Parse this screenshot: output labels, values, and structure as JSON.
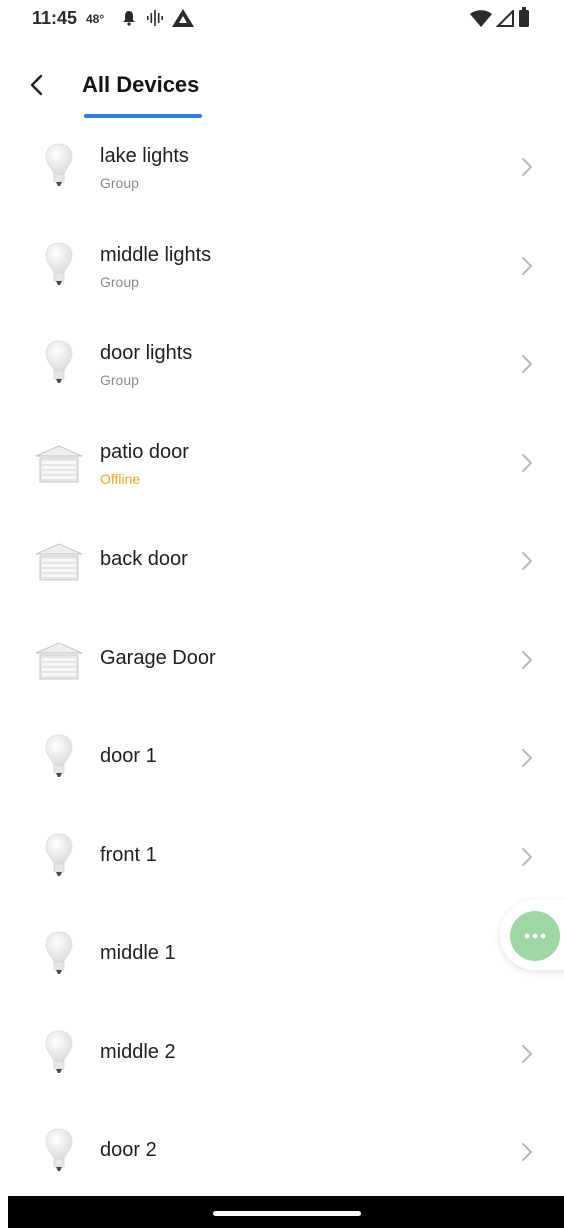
{
  "status_bar": {
    "time": "11:45",
    "temperature": "48°",
    "icons": [
      "notification-bell-icon",
      "vibrate-icon",
      "drive-icon",
      "wifi-icon",
      "signal-icon",
      "battery-icon"
    ]
  },
  "header": {
    "title": "All Devices",
    "back_icon": "chevron-left-icon",
    "accent_color": "#2f7ae5"
  },
  "devices": [
    {
      "name": "lake lights",
      "subtitle": "Group",
      "icon": "bulb-icon"
    },
    {
      "name": "middle lights",
      "subtitle": "Group",
      "icon": "bulb-icon"
    },
    {
      "name": "door lights",
      "subtitle": "Group",
      "icon": "bulb-icon"
    },
    {
      "name": "patio door",
      "subtitle": "Offline",
      "icon": "garage-door-icon",
      "status_color": "#f5a623"
    },
    {
      "name": "back door",
      "subtitle": "",
      "icon": "garage-door-icon"
    },
    {
      "name": "Garage Door",
      "subtitle": "",
      "icon": "garage-door-icon"
    },
    {
      "name": "door 1",
      "subtitle": "",
      "icon": "bulb-icon"
    },
    {
      "name": "front 1",
      "subtitle": "",
      "icon": "bulb-icon"
    },
    {
      "name": "middle 1",
      "subtitle": "",
      "icon": "bulb-icon"
    },
    {
      "name": "middle 2",
      "subtitle": "",
      "icon": "bulb-icon"
    },
    {
      "name": "door 2",
      "subtitle": "",
      "icon": "bulb-icon"
    }
  ],
  "fab": {
    "icon": "more-dots-icon",
    "color": "#9fd6a6"
  }
}
